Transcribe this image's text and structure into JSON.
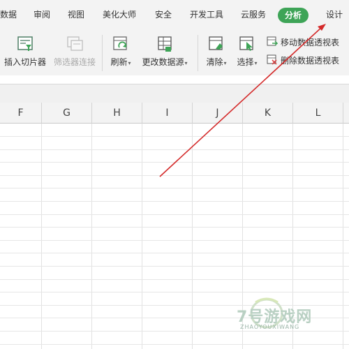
{
  "menu": {
    "tabs": [
      {
        "label": "数据"
      },
      {
        "label": "审阅"
      },
      {
        "label": "视图"
      },
      {
        "label": "美化大师"
      },
      {
        "label": "安全"
      },
      {
        "label": "开发工具"
      },
      {
        "label": "云服务"
      },
      {
        "label": "分析",
        "active": true
      },
      {
        "label": "设计"
      }
    ]
  },
  "ribbon": {
    "insert_slicer": "插入切片器",
    "filter_connections": "筛选器连接",
    "refresh": "刷新",
    "change_source": "更改数据源",
    "clear": "清除",
    "select": "选择",
    "move_pivot": "移动数据透视表",
    "delete_pivot": "删除数据透视表",
    "caret": "▾"
  },
  "grid": {
    "columns": [
      "F",
      "G",
      "H",
      "I",
      "J",
      "K",
      "L"
    ]
  },
  "watermark": {
    "text": "7号游戏网",
    "sub": "ZHAOYOUXIWANG"
  },
  "colors": {
    "active_tab": "#3ea457",
    "annotation_arrow": "#d42a2a"
  }
}
